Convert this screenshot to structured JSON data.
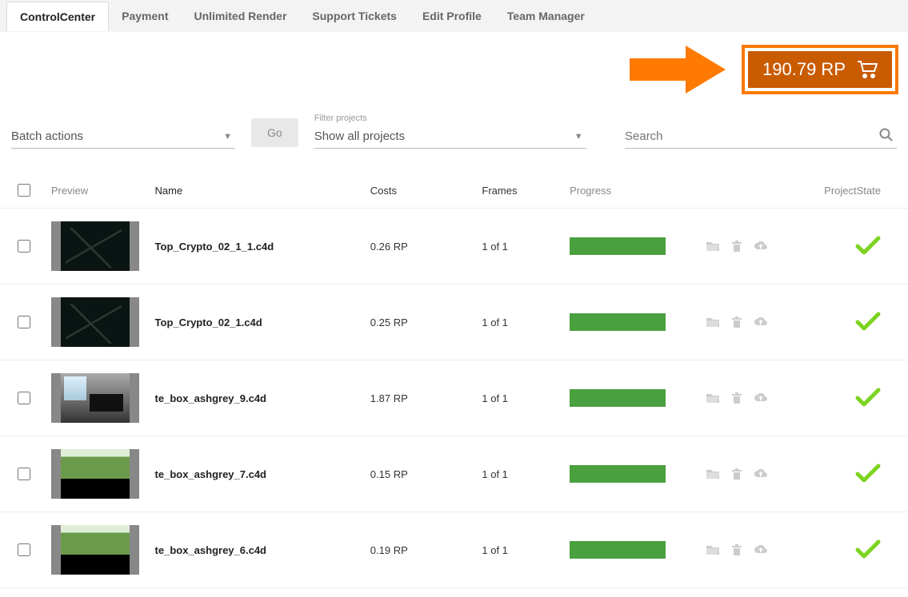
{
  "tabs": [
    {
      "label": "ControlCenter",
      "active": true
    },
    {
      "label": "Payment",
      "active": false
    },
    {
      "label": "Unlimited Render",
      "active": false
    },
    {
      "label": "Support Tickets",
      "active": false
    },
    {
      "label": "Edit Profile",
      "active": false
    },
    {
      "label": "Team Manager",
      "active": false
    }
  ],
  "balance": {
    "text": "190.79 RP"
  },
  "filters": {
    "batch_label": "Batch actions",
    "go_label": "Go",
    "filter_caption": "Filter projects",
    "filter_value": "Show all projects",
    "search_placeholder": "Search"
  },
  "columns": {
    "preview": "Preview",
    "name": "Name",
    "costs": "Costs",
    "frames": "Frames",
    "progress": "Progress",
    "state": "ProjectState"
  },
  "rows": [
    {
      "name": "Top_Crypto_02_1_1.c4d",
      "costs": "0.26 RP",
      "frames": "1 of 1",
      "thumb": "dark",
      "progress": 100,
      "state": "done"
    },
    {
      "name": "Top_Crypto_02_1.c4d",
      "costs": "0.25 RP",
      "frames": "1 of 1",
      "thumb": "dark",
      "progress": 100,
      "state": "done"
    },
    {
      "name": "te_box_ashgrey_9.c4d",
      "costs": "1.87 RP",
      "frames": "1 of 1",
      "thumb": "room",
      "progress": 100,
      "state": "done"
    },
    {
      "name": "te_box_ashgrey_7.c4d",
      "costs": "0.15 RP",
      "frames": "1 of 1",
      "thumb": "green",
      "progress": 100,
      "state": "done"
    },
    {
      "name": "te_box_ashgrey_6.c4d",
      "costs": "0.19 RP",
      "frames": "1 of 1",
      "thumb": "green",
      "progress": 100,
      "state": "done"
    }
  ],
  "colors": {
    "accent_orange": "#ff7a00",
    "balance_bg": "#c95b00",
    "progress_green": "#4aa03f",
    "check_green": "#7ed321"
  }
}
